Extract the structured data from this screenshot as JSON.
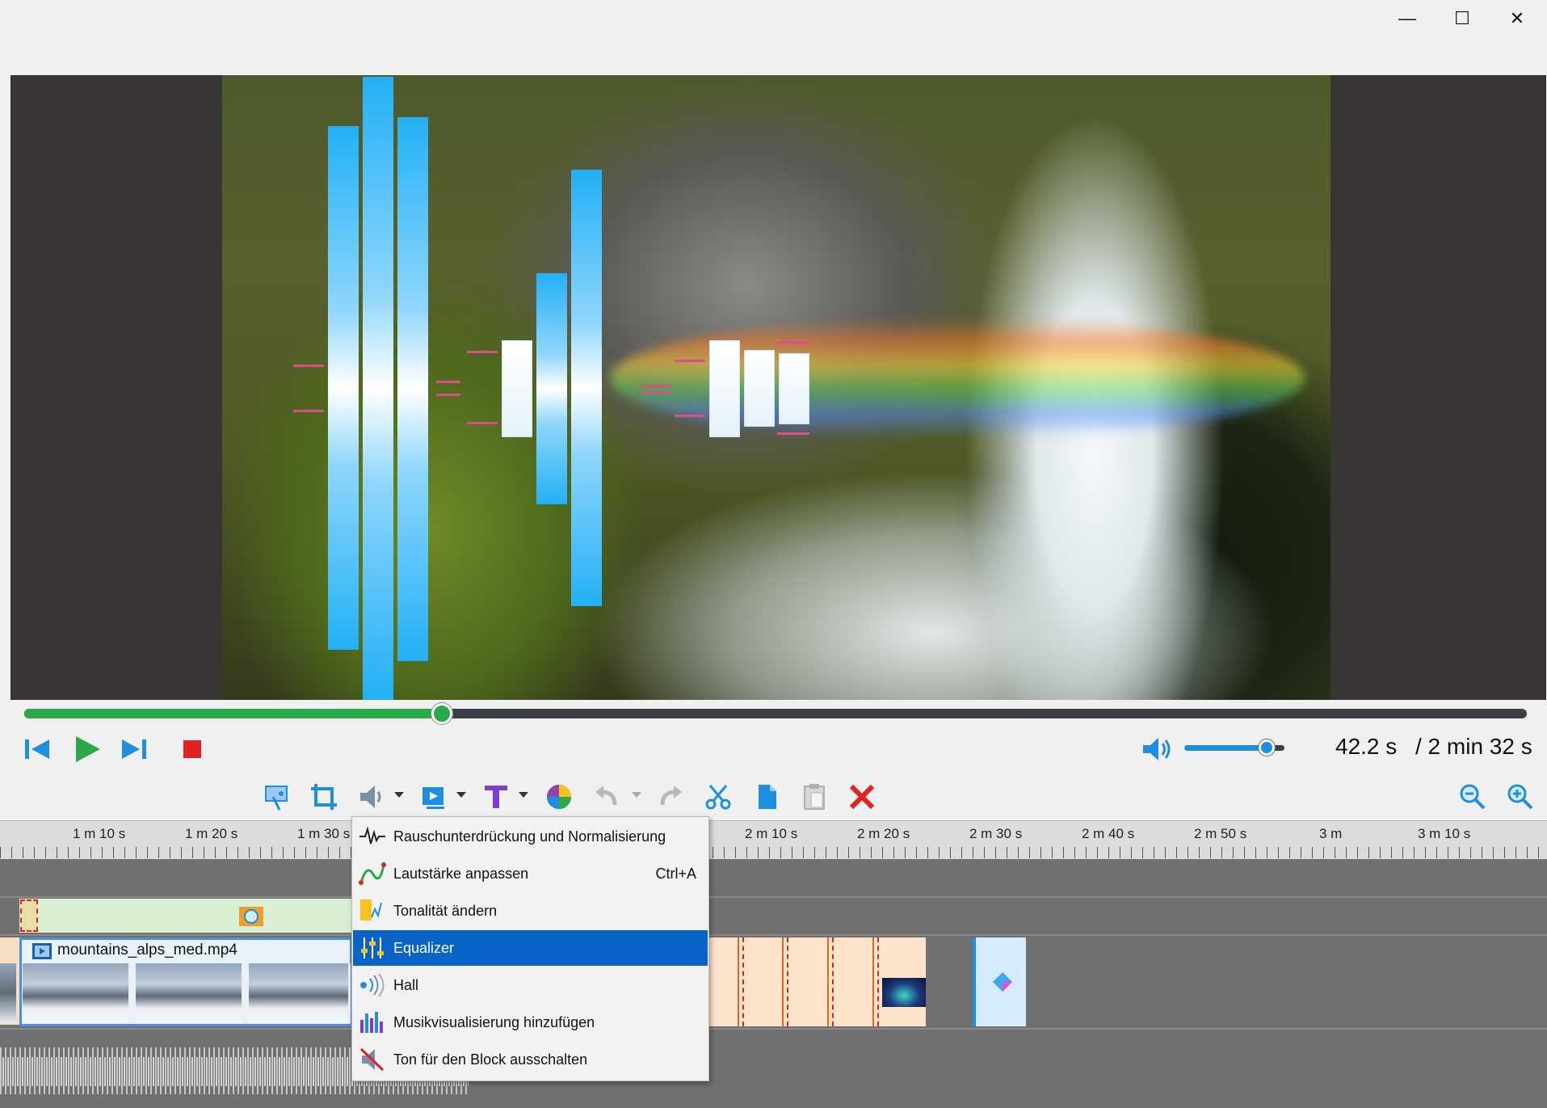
{
  "window": {
    "minimize_glyph": "—",
    "maximize_glyph": "☐",
    "close_glyph": "✕"
  },
  "player": {
    "current_time": "42.2 s",
    "total_time": "/ 2 min 32 s",
    "seek_progress": 0.278,
    "volume_level": 0.82
  },
  "ruler": {
    "labels": [
      "1 m 10 s",
      "1 m 20 s",
      "1 m 30 s",
      "2 m 10 s",
      "2 m 20 s",
      "2 m 30 s",
      "2 m 40 s",
      "2 m 50 s",
      "3 m",
      "3 m 10 s"
    ]
  },
  "timeline": {
    "video_clip_name": "mountains_alps_med.mp4"
  },
  "context_menu": {
    "items": [
      {
        "label": "Rauschunterdrückung und Normalisierung",
        "icon": "waveform-icon",
        "shortcut": ""
      },
      {
        "label": "Lautstärke anpassen",
        "icon": "volume-curve-icon",
        "shortcut": "Ctrl+A"
      },
      {
        "label": "Tonalität ändern",
        "icon": "pitch-icon",
        "shortcut": ""
      },
      {
        "label": "Equalizer",
        "icon": "equalizer-icon",
        "shortcut": ""
      },
      {
        "label": "Hall",
        "icon": "reverb-icon",
        "shortcut": ""
      },
      {
        "label": "Musikvisualisierung hinzufügen",
        "icon": "visualizer-icon",
        "shortcut": ""
      },
      {
        "label": "Ton für den Block ausschalten",
        "icon": "mute-icon",
        "shortcut": ""
      }
    ],
    "selected_index": 3
  },
  "colors": {
    "accent": "#0a64c8",
    "seek_green": "#2aa84a",
    "volume_blue": "#1e8fe0"
  }
}
